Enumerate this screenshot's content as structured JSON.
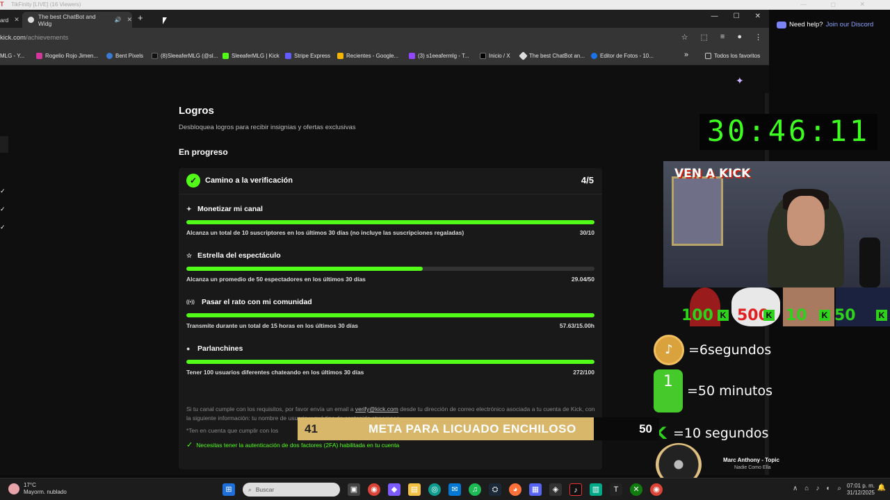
{
  "window": {
    "title": "TikFinity [LIVE] (16 Viewers)",
    "controls": "— ◻ ✕"
  },
  "tabs": [
    {
      "label": "ard"
    },
    {
      "label": "The best ChatBot and Widg",
      "audio": "🔊"
    }
  ],
  "newtab": "+",
  "window_buttons": {
    "min": "—",
    "max": "☐",
    "close": "✕"
  },
  "url": {
    "host": "kick.com",
    "path": "/achievements"
  },
  "url_icons": [
    "☆",
    "⬚",
    "≡",
    "●",
    "⋮"
  ],
  "bookmarks": [
    {
      "label": "MLG - Y...",
      "color": "#ff3b30"
    },
    {
      "label": "Rogelio Rojo Jimen...",
      "color": "#d4379b"
    },
    {
      "label": "Bent Pixels",
      "color": "#3a7bd5"
    },
    {
      "label": "(8)SleeaferMLG (@sl...",
      "color": "#111111"
    },
    {
      "label": "SleeaferMLG | Kick",
      "color": "#53fc18"
    },
    {
      "label": "Stripe Express",
      "color": "#635bff"
    },
    {
      "label": "Recientes - Google...",
      "color": "#f4b400"
    },
    {
      "label": "(3) s1eeafermlg - T...",
      "color": "#9146ff"
    },
    {
      "label": "Inicio / X",
      "color": "#000000"
    },
    {
      "label": "The best ChatBot an...",
      "color": "#dddddd"
    },
    {
      "label": "Editor de Fotos - 10...",
      "color": "#1a73e8"
    }
  ],
  "bookmarks_more": "»",
  "all_favorites": "Todos los favoritos",
  "page": {
    "title": "Logros",
    "subtitle": "Desbloquea logros para recibir insignias y ofertas exclusivas",
    "section": "En progreso",
    "card": {
      "badge": "✓",
      "title": "Camino a la verificación",
      "count": "4/5",
      "tasks": [
        {
          "icon": "✦",
          "title": "Monetizar mi canal",
          "desc": "Alcanza un total de 10 suscriptores en los últimos 30 días (no incluye las suscripciones regaladas)",
          "value": "30/10",
          "progress": 1.0
        },
        {
          "icon": "☆",
          "title": "Estrella del espectáculo",
          "desc": "Alcanza un promedio de 50 espectadores en los últimos 30 días",
          "value": "29.04/50",
          "progress": 0.58
        },
        {
          "icon": "((•))",
          "title": "Pasar el rato con mi comunidad",
          "desc": "Transmite durante un total de 15 horas en los últimos 30 días",
          "value": "57.63/15.00h",
          "progress": 1.0
        },
        {
          "icon": "●",
          "title": "Parlanchines",
          "desc": "Tener 100 usuarios diferentes chateando en los últimos 30 días",
          "value": "272/100",
          "progress": 1.0
        }
      ],
      "note_pre": "Si tu canal cumple con los requisitos, por favor envía un email a ",
      "note_email": "verify@kick.com",
      "note_post": " desde tu dirección de correo electrónico asociada a tu cuenta de Kick, con la siguiente información: tu nombre de usuario y qué tipo de contenido streameas.",
      "note2": "*Ten en cuenta que cumplir con los",
      "note3": "Necesitas tener la autenticación de dos factores (2FA) habilitada en tu cuenta",
      "note3_icon": "✓"
    },
    "side_checks": [
      "✓",
      "✓",
      "✓"
    ]
  },
  "overlay": {
    "help": "Need help?",
    "join": "Join our Discord",
    "timer": "30:46:11",
    "cam_text": "VEN A KICK",
    "goals": [
      "100",
      "500",
      "10",
      "50"
    ],
    "k_glyph": "K",
    "legend": [
      {
        "text": "=6segundos",
        "icon": "♪"
      },
      {
        "text": "=50 minutos",
        "icon": "1"
      },
      {
        "text": "=10 segundos",
        "icon": "K"
      }
    ],
    "meta": {
      "start": "41",
      "label": "META PARA LICUADO ENCHILOSO",
      "end": "50",
      "progress": 0.82
    },
    "music": {
      "song": "Marc Anthony - Topic",
      "artist": "Nadie Como Ella"
    }
  },
  "taskbar": {
    "temp": "17°C",
    "weather": "Mayorm. nublado",
    "search_placeholder": "Buscar",
    "time": "07:01 p. m.",
    "date": "31/12/2025",
    "apps": [
      "▣",
      "◉",
      "◆",
      "▤",
      "◎",
      "✉",
      "♫",
      "⛭",
      "◕",
      "▦",
      "◈",
      "♪",
      "▥",
      "T",
      "✕",
      "◉"
    ],
    "tray": [
      "∧",
      "⌂",
      "♪",
      "◐",
      "⌕"
    ]
  }
}
